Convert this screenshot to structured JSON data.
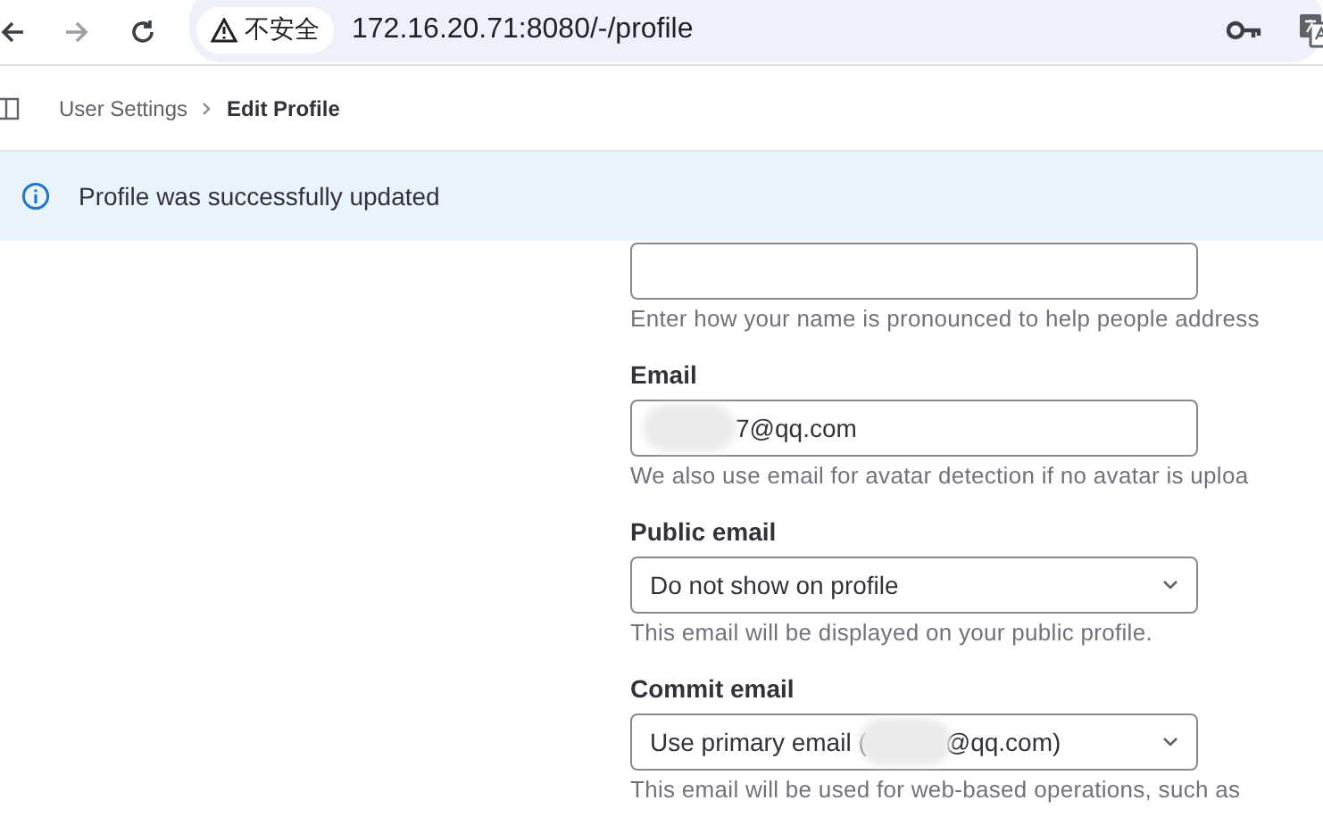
{
  "browser": {
    "security_label": "不安全",
    "url": "172.16.20.71:8080/-/profile"
  },
  "breadcrumbs": [
    {
      "label": "User Settings",
      "current": false
    },
    {
      "label": "Edit Profile",
      "current": true
    }
  ],
  "alert": {
    "message": "Profile was successfully updated"
  },
  "fields": [
    {
      "kind": "input",
      "redacted": false,
      "help": "Enter how your name is pronounced to help people address"
    },
    {
      "kind": "input",
      "label": "Email",
      "value_suffix": "7@qq.com",
      "redacted": true,
      "help": "We also use email for avatar detection if no avatar is uploa"
    },
    {
      "kind": "select",
      "label": "Public email",
      "value_prefix": "Do not show on profile",
      "redacted": false,
      "help": "This email will be displayed on your public profile."
    },
    {
      "kind": "select",
      "label": "Commit email",
      "value_prefix": "Use primary email (",
      "value_suffix": "@qq.com)",
      "redacted": true,
      "help": "This email will be used for web-based operations, such as"
    }
  ]
}
